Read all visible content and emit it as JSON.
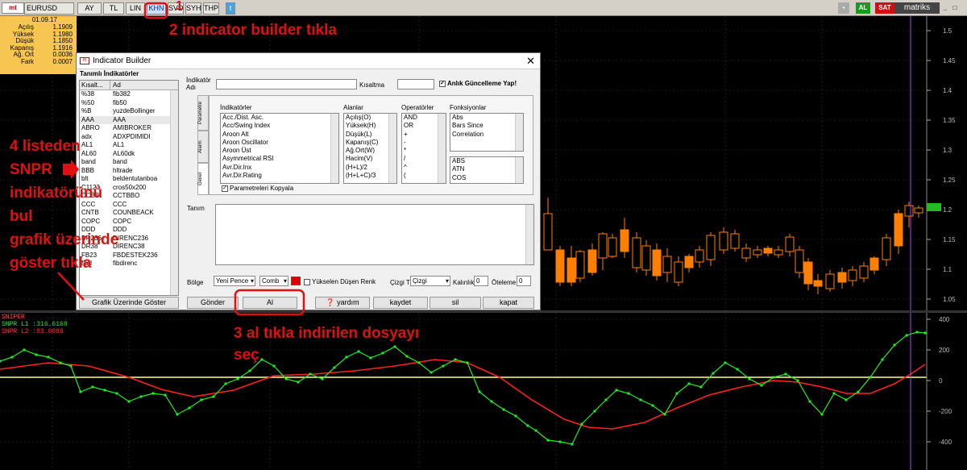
{
  "toolbar": {
    "symbol": "EURUSD",
    "buttons": [
      "AY",
      "TL",
      "LIN",
      "KHN",
      "SVD",
      "SYH",
      "THP"
    ],
    "right_badges": [
      "AL",
      "SAT"
    ],
    "brand": "matriks"
  },
  "price_panel": {
    "date": "01.09.17",
    "rows": [
      {
        "k": "Açılış",
        "v": "1.1909"
      },
      {
        "k": "Yüksek",
        "v": "1.1980"
      },
      {
        "k": "Düşük",
        "v": "1.1850"
      },
      {
        "k": "Kapanış",
        "v": "1.1916"
      },
      {
        "k": "Ağ. Ort",
        "v": "0.0036"
      },
      {
        "k": "Fark",
        "v": "0.0007"
      }
    ]
  },
  "price_axis": [
    "1.5",
    "1.45",
    "1.4",
    "1.35",
    "1.3",
    "1.25",
    "1.2",
    "1.15",
    "1.1",
    "1.05"
  ],
  "price_current": "1.19",
  "osc_axis": [
    "400",
    "200",
    "0",
    "-200",
    "-400"
  ],
  "osc_legend": {
    "title": "SNIPER",
    "l1": "SNPR L1",
    "l1_val": ":316.6168",
    "l2": "SNPR L2",
    "l2_val": ":83.0889"
  },
  "colors": {
    "green": "#22ee22",
    "red": "#ff2020",
    "candle": "#ff7f00",
    "yellow": "#ffff88"
  },
  "dialog": {
    "title": "Indicator Builder",
    "close": "✕",
    "defined_label": "Tanımlı İndikatörler",
    "list_headers": [
      "Kısalt...",
      "Ad"
    ],
    "list_rows": [
      [
        "%38",
        "fib382"
      ],
      [
        "%50",
        "fib50"
      ],
      [
        "%B",
        "yuzdeBollinger"
      ],
      [
        "AAA",
        "AAA"
      ],
      [
        "ABRO",
        "AMIBROKER"
      ],
      [
        "adx",
        "ADXPDIMIDI"
      ],
      [
        "AL1",
        "AL1"
      ],
      [
        "AL60",
        "AL60dk"
      ],
      [
        "band",
        "band"
      ],
      [
        "BBB",
        "hltrade"
      ],
      [
        "blt",
        "beldentutanboa"
      ],
      [
        "C1123",
        "cros50x200"
      ],
      [
        "CCBB",
        "CCTBBO"
      ],
      [
        "CCC",
        "CCC"
      ],
      [
        "CNTB",
        "COUNBEACK"
      ],
      [
        "COPC",
        "COPC"
      ],
      [
        "DDD",
        "DDD"
      ],
      [
        "DR236",
        "DIRENC236"
      ],
      [
        "DR38",
        "DIRENC38"
      ],
      [
        "FB23",
        "FBDESTEK236"
      ],
      [
        "fibd",
        "fibdirenc"
      ]
    ],
    "show_on_chart": "Grafik Üzerinde Göster",
    "name_label": "İndikatör Adı",
    "short_label": "Kısaltma",
    "instant_update": "Anlık Güncelleme Yap!",
    "tabs": [
      "Parametre",
      "Alarm",
      "Genel"
    ],
    "indicators_header": "İndikatörler",
    "indicators": [
      "Acc./Dist. Asc.",
      "Acc/Swing Index",
      "Aroon Alt",
      "Aroon Oscillator",
      "Aroon Üst",
      "Asymmetrical RSI",
      "Avr.Dir.Inx",
      "Avr.Dir.Rating"
    ],
    "fields_header": "Alanlar",
    "fields": [
      "Açılış(O)",
      "Yüksek(H)",
      "Düşük(L)",
      "Kapanış(C)",
      "Ağ.Ort(W)",
      "Hacim(V)",
      "(H+L)/2",
      "(H+L+C)/3"
    ],
    "operators_header": "Operatörler",
    "operators": [
      "AND",
      "OR",
      "+",
      "-",
      "*",
      "/",
      "^",
      "("
    ],
    "functions_header": "Fonksiyonlar",
    "functions": [
      "Abs",
      "Bars Since",
      "Correlation"
    ],
    "math_functions": [
      "ABS",
      "ATN",
      "COS"
    ],
    "copy_params": "Parametreleri Kopyala",
    "desc_label": "Tanım",
    "region_label": "Bölge",
    "region_value": "Yeni Pence",
    "comb_value": "Comb",
    "rising_falling": "Yükselen Düşen Renk",
    "line_type_label": "Çizgi Tipi",
    "line_type_value": "Çizgi",
    "thickness_label": "Kalınlık",
    "thickness_value": "0",
    "offset_label": "Öteleme",
    "offset_value": "0",
    "buttons": {
      "send": "Gönder",
      "buy": "Al",
      "help": "yardım",
      "save": "kaydet",
      "delete": "sil",
      "close": "kapat"
    }
  },
  "annotations": {
    "a1": "1",
    "a2": "2 indicator builder tıkla",
    "a3": "3 al tıkla indirilen dosyayı seç",
    "a3_l1": "3 al tıkla indirilen dosyayı",
    "a3_l2": "seç",
    "a4_lines": [
      "4 listeden",
      "SNPR",
      "indikatörünü",
      "bul",
      "grafik üzerinde",
      "göster tıkla"
    ]
  }
}
